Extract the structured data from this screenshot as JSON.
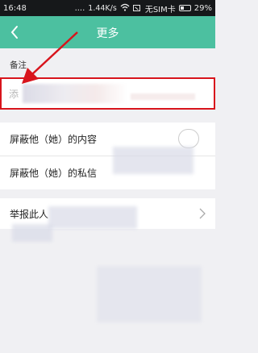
{
  "status_bar": {
    "time": "16:48",
    "signal_dots": "....",
    "speed": "1.44K/s",
    "sim_text": "无SIM卡",
    "battery": "29%"
  },
  "nav": {
    "title": "更多",
    "color": "#4cc0a0"
  },
  "remark": {
    "label": "备注",
    "placeholder": "添",
    "highlight_color": "#d8141c"
  },
  "privacy": {
    "hide_content_label": "屏蔽他（她）的内容",
    "hide_message_label": "屏蔽他（她）的私信"
  },
  "report": {
    "label": "举报此人"
  },
  "icons": [
    "back-arrow-icon",
    "wifi-icon",
    "sim-icon",
    "battery-icon",
    "chevron-right-icon",
    "annotation-arrow"
  ]
}
